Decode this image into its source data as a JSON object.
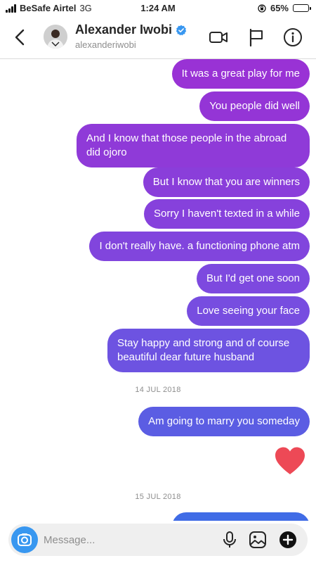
{
  "status_bar": {
    "carrier": "BeSafe Airtel",
    "network": "3G",
    "time": "1:24 AM",
    "battery_text": "65%",
    "battery_level": 0.65
  },
  "header": {
    "contact_name": "Alexander Iwobi",
    "username": "alexanderiwobi",
    "verified": true
  },
  "messages": [
    {
      "text": "It was a great play for me",
      "from": "me"
    },
    {
      "text": "You people did well",
      "from": "me"
    },
    {
      "text": "And I know that those people in the abroad did ojoro",
      "from": "me"
    },
    {
      "text": "But I know that you are winners",
      "from": "me"
    },
    {
      "text": "Sorry I haven't texted in a while",
      "from": "me"
    },
    {
      "text": "I don't really have. a functioning phone atm",
      "from": "me"
    },
    {
      "text": "But I'd get one soon",
      "from": "me"
    },
    {
      "text": "Love seeing your face",
      "from": "me"
    },
    {
      "text": "Stay happy and strong and of course beautiful dear future husband",
      "from": "me"
    }
  ],
  "date_separators": [
    "14 JUL 2018",
    "15 JUL 2018"
  ],
  "messages_after_first_date": [
    {
      "text": "Am going to marry you someday",
      "from": "me"
    }
  ],
  "reaction": {
    "type": "heart",
    "color": "#ed4956"
  },
  "composer": {
    "placeholder": "Message...",
    "icons": [
      "camera-icon",
      "microphone-icon",
      "gallery-icon",
      "plus-icon"
    ]
  },
  "colors": {
    "bubble_top": "#9b30d4",
    "bubble_mid": "#7a4be0",
    "bubble_bottom": "#3d6ee6",
    "accent_blue": "#3897f0"
  }
}
